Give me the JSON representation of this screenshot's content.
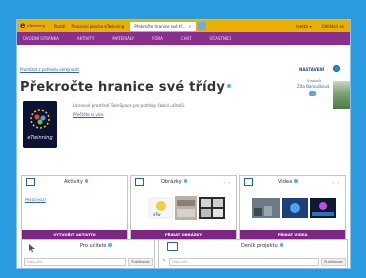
{
  "topbar": {
    "logo_text": "eTwinning",
    "links": [
      "Portál",
      "Pracovní plocha eTwinning"
    ],
    "active_tab": "Překročte hranice své tř...",
    "user_menu": "Ivetka ▾",
    "logout": "Odhlásit se"
  },
  "menu": {
    "items": [
      "Úvodní stránka",
      "Aktivity",
      "Materiály",
      "Fóra",
      "Chat",
      "Účastníci"
    ]
  },
  "header": {
    "back_link": "Prohlížet z pohledu veřejnosti",
    "settings_label": "NASTAVENÍ",
    "title": "Překročte hranice své třídy",
    "creator_label": "Vlastník",
    "creator_name": "Zita Baroušková",
    "description": "Ucenové prostředí TwinSpace pro potřeby školní učitelů.",
    "read_more": "Přečtěte si více",
    "badge_text": "eTwinning"
  },
  "panels": {
    "activities": {
      "title": "Aktivity",
      "recent": "PŘEDCHOZÍ",
      "button": "Vytvořit aktivitu"
    },
    "images": {
      "title": "Obrázky",
      "arrows": "‹ ›",
      "button": "Přidat obrázky"
    },
    "videos": {
      "title": "Videa",
      "arrows": "‹ ›",
      "button": "Přidat videa"
    }
  },
  "lower": {
    "teachers": {
      "title": "Pro učitele",
      "placeholder": "Hlou uče",
      "button": "Publikovat"
    },
    "diary": {
      "title": "Deník projektu",
      "placeholder": "Hlou uče",
      "button": "Publikovat"
    }
  },
  "colors": {
    "page_bg": "#2b9be0",
    "topbar": "#e9b000",
    "menu": "#8b2f8f",
    "button": "#7d2585",
    "link": "#2760c2"
  }
}
